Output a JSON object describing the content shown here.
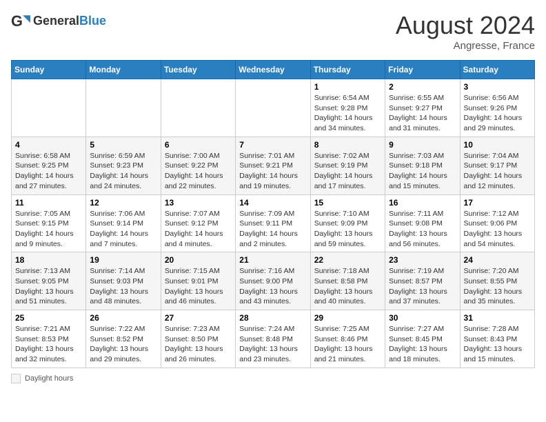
{
  "header": {
    "logo_general": "General",
    "logo_blue": "Blue",
    "month_title": "August 2024",
    "subtitle": "Angresse, France"
  },
  "legend": {
    "label": "Daylight hours"
  },
  "days_of_week": [
    "Sunday",
    "Monday",
    "Tuesday",
    "Wednesday",
    "Thursday",
    "Friday",
    "Saturday"
  ],
  "weeks": [
    [
      {
        "day": "",
        "info": ""
      },
      {
        "day": "",
        "info": ""
      },
      {
        "day": "",
        "info": ""
      },
      {
        "day": "",
        "info": ""
      },
      {
        "day": "1",
        "info": "Sunrise: 6:54 AM\nSunset: 9:28 PM\nDaylight: 14 hours and 34 minutes."
      },
      {
        "day": "2",
        "info": "Sunrise: 6:55 AM\nSunset: 9:27 PM\nDaylight: 14 hours and 31 minutes."
      },
      {
        "day": "3",
        "info": "Sunrise: 6:56 AM\nSunset: 9:26 PM\nDaylight: 14 hours and 29 minutes."
      }
    ],
    [
      {
        "day": "4",
        "info": "Sunrise: 6:58 AM\nSunset: 9:25 PM\nDaylight: 14 hours and 27 minutes."
      },
      {
        "day": "5",
        "info": "Sunrise: 6:59 AM\nSunset: 9:23 PM\nDaylight: 14 hours and 24 minutes."
      },
      {
        "day": "6",
        "info": "Sunrise: 7:00 AM\nSunset: 9:22 PM\nDaylight: 14 hours and 22 minutes."
      },
      {
        "day": "7",
        "info": "Sunrise: 7:01 AM\nSunset: 9:21 PM\nDaylight: 14 hours and 19 minutes."
      },
      {
        "day": "8",
        "info": "Sunrise: 7:02 AM\nSunset: 9:19 PM\nDaylight: 14 hours and 17 minutes."
      },
      {
        "day": "9",
        "info": "Sunrise: 7:03 AM\nSunset: 9:18 PM\nDaylight: 14 hours and 15 minutes."
      },
      {
        "day": "10",
        "info": "Sunrise: 7:04 AM\nSunset: 9:17 PM\nDaylight: 14 hours and 12 minutes."
      }
    ],
    [
      {
        "day": "11",
        "info": "Sunrise: 7:05 AM\nSunset: 9:15 PM\nDaylight: 14 hours and 9 minutes."
      },
      {
        "day": "12",
        "info": "Sunrise: 7:06 AM\nSunset: 9:14 PM\nDaylight: 14 hours and 7 minutes."
      },
      {
        "day": "13",
        "info": "Sunrise: 7:07 AM\nSunset: 9:12 PM\nDaylight: 14 hours and 4 minutes."
      },
      {
        "day": "14",
        "info": "Sunrise: 7:09 AM\nSunset: 9:11 PM\nDaylight: 14 hours and 2 minutes."
      },
      {
        "day": "15",
        "info": "Sunrise: 7:10 AM\nSunset: 9:09 PM\nDaylight: 13 hours and 59 minutes."
      },
      {
        "day": "16",
        "info": "Sunrise: 7:11 AM\nSunset: 9:08 PM\nDaylight: 13 hours and 56 minutes."
      },
      {
        "day": "17",
        "info": "Sunrise: 7:12 AM\nSunset: 9:06 PM\nDaylight: 13 hours and 54 minutes."
      }
    ],
    [
      {
        "day": "18",
        "info": "Sunrise: 7:13 AM\nSunset: 9:05 PM\nDaylight: 13 hours and 51 minutes."
      },
      {
        "day": "19",
        "info": "Sunrise: 7:14 AM\nSunset: 9:03 PM\nDaylight: 13 hours and 48 minutes."
      },
      {
        "day": "20",
        "info": "Sunrise: 7:15 AM\nSunset: 9:01 PM\nDaylight: 13 hours and 46 minutes."
      },
      {
        "day": "21",
        "info": "Sunrise: 7:16 AM\nSunset: 9:00 PM\nDaylight: 13 hours and 43 minutes."
      },
      {
        "day": "22",
        "info": "Sunrise: 7:18 AM\nSunset: 8:58 PM\nDaylight: 13 hours and 40 minutes."
      },
      {
        "day": "23",
        "info": "Sunrise: 7:19 AM\nSunset: 8:57 PM\nDaylight: 13 hours and 37 minutes."
      },
      {
        "day": "24",
        "info": "Sunrise: 7:20 AM\nSunset: 8:55 PM\nDaylight: 13 hours and 35 minutes."
      }
    ],
    [
      {
        "day": "25",
        "info": "Sunrise: 7:21 AM\nSunset: 8:53 PM\nDaylight: 13 hours and 32 minutes."
      },
      {
        "day": "26",
        "info": "Sunrise: 7:22 AM\nSunset: 8:52 PM\nDaylight: 13 hours and 29 minutes."
      },
      {
        "day": "27",
        "info": "Sunrise: 7:23 AM\nSunset: 8:50 PM\nDaylight: 13 hours and 26 minutes."
      },
      {
        "day": "28",
        "info": "Sunrise: 7:24 AM\nSunset: 8:48 PM\nDaylight: 13 hours and 23 minutes."
      },
      {
        "day": "29",
        "info": "Sunrise: 7:25 AM\nSunset: 8:46 PM\nDaylight: 13 hours and 21 minutes."
      },
      {
        "day": "30",
        "info": "Sunrise: 7:27 AM\nSunset: 8:45 PM\nDaylight: 13 hours and 18 minutes."
      },
      {
        "day": "31",
        "info": "Sunrise: 7:28 AM\nSunset: 8:43 PM\nDaylight: 13 hours and 15 minutes."
      }
    ]
  ]
}
